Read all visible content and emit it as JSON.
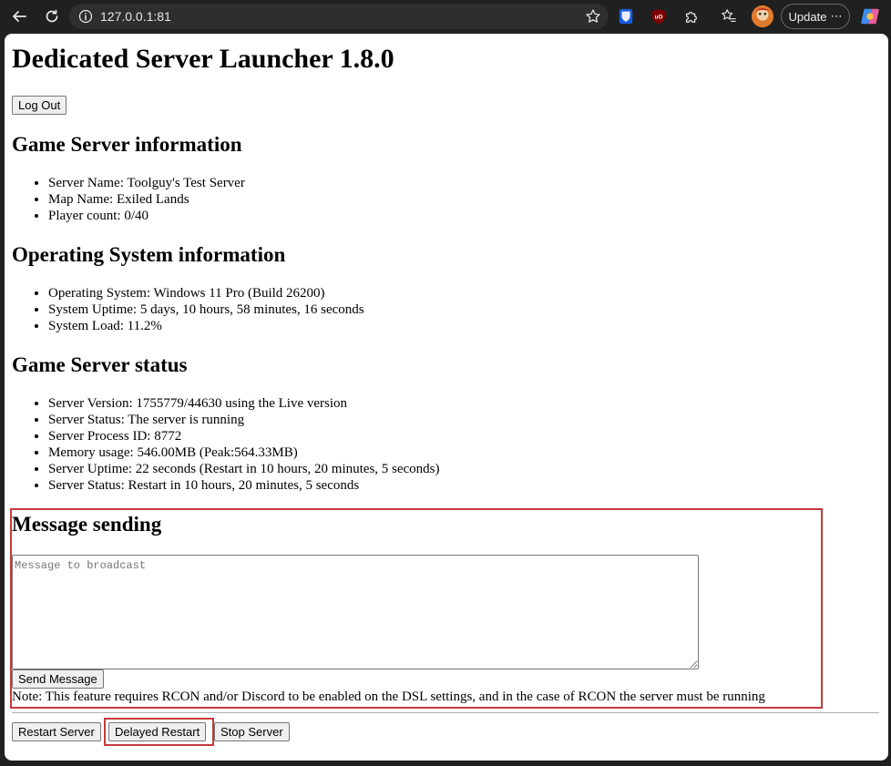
{
  "browser": {
    "url": "127.0.0.1:81",
    "update_label": "Update",
    "update_more": "⋯"
  },
  "page": {
    "title": "Dedicated Server Launcher 1.8.0",
    "logout_label": "Log Out",
    "game_server_info": {
      "heading": "Game Server information",
      "items": [
        "Server Name: Toolguy's Test Server",
        "Map Name: Exiled Lands",
        "Player count: 0/40"
      ]
    },
    "os_info": {
      "heading": "Operating System information",
      "items": [
        "Operating System: Windows 11 Pro (Build 26200)",
        "System Uptime: 5 days, 10 hours, 58 minutes, 16 seconds",
        "System Load: 11.2%"
      ]
    },
    "server_status": {
      "heading": "Game Server status",
      "items": [
        "Server Version: 1755779/44630 using the Live version",
        "Server Status: The server is running",
        "Server Process ID: 8772",
        "Memory usage: 546.00MB (Peak:564.33MB)",
        "Server Uptime: 22 seconds (Restart in 10 hours, 20 minutes, 5 seconds)",
        "Server Status: Restart in 10 hours, 20 minutes, 5 seconds"
      ]
    },
    "message": {
      "heading": "Message sending",
      "placeholder": "Message to broadcast",
      "send_label": "Send Message",
      "note": "Note: This feature requires RCON and/or Discord to be enabled on the DSL settings, and in the case of RCON the server must be running"
    },
    "controls": {
      "restart_label": "Restart Server",
      "delayed_restart_label": "Delayed Restart",
      "stop_label": "Stop Server"
    },
    "colors": {
      "highlight": "#c43a3a"
    }
  }
}
